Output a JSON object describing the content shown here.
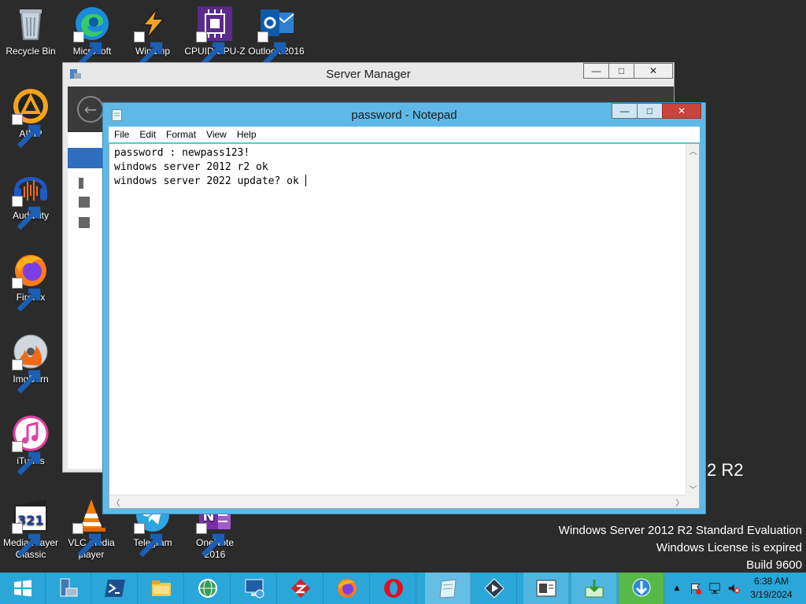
{
  "desktop": {
    "icons": [
      {
        "label": "Recycle Bin",
        "icon": "recycle-bin-icon"
      },
      {
        "label": "Microsoft Edge",
        "icon": "edge-icon"
      },
      {
        "label": "Winamp",
        "icon": "winamp-icon"
      },
      {
        "label": "CPUID CPU-Z",
        "icon": "cpuz-icon"
      },
      {
        "label": "Outlook 2016",
        "icon": "outlook-icon"
      },
      {
        "label": "AIMP",
        "icon": "aimp-icon"
      },
      {
        "label": "Audacity",
        "icon": "audacity-icon"
      },
      {
        "label": "Firefox",
        "icon": "firefox-icon"
      },
      {
        "label": "ImgBurn",
        "icon": "imgburn-icon"
      },
      {
        "label": "iTunes",
        "icon": "itunes-icon"
      },
      {
        "label": "Media Player Classic",
        "icon": "mpc-icon"
      },
      {
        "label": "VLC media player",
        "icon": "vlc-icon"
      },
      {
        "label": "Telegram",
        "icon": "telegram-icon"
      },
      {
        "label": "OneNote 2016",
        "icon": "onenote-icon"
      }
    ],
    "watermark": {
      "partial_logo_text": "2 R2",
      "line1": "Windows Server 2012 R2 Standard Evaluation",
      "line2": "Windows License is expired",
      "line3": "Build 9600"
    }
  },
  "server_manager": {
    "title": "Server Manager",
    "minimize": "—",
    "maximize": "□",
    "close": "✕"
  },
  "notepad": {
    "title": "password - Notepad",
    "minimize": "—",
    "maximize": "□",
    "close": "✕",
    "menu": [
      "File",
      "Edit",
      "Format",
      "View",
      "Help"
    ],
    "content": "password : newpass123!\nwindows server 2012 r2 ok\nwindows server 2022 update? ok "
  },
  "taskbar": {
    "buttons": [
      "start-icon",
      "server-manager-icon",
      "powershell-icon",
      "file-explorer-icon",
      "network-globe-icon",
      "remote-desktop-icon",
      "filezilla-icon",
      "firefox-icon",
      "opera-icon",
      "notepad-icon",
      "app-icon",
      "terminal-icon",
      "download-icon",
      "idm-icon"
    ],
    "tray_up": "▲",
    "clock_time": "6:38 AM",
    "clock_date": "3/19/2024"
  },
  "colors": {
    "desktop_bg": "#2b2b2b",
    "taskbar_bg": "#2aa6d9",
    "notepad_frame": "#5fb9e6",
    "close_red": "#c7453a"
  }
}
